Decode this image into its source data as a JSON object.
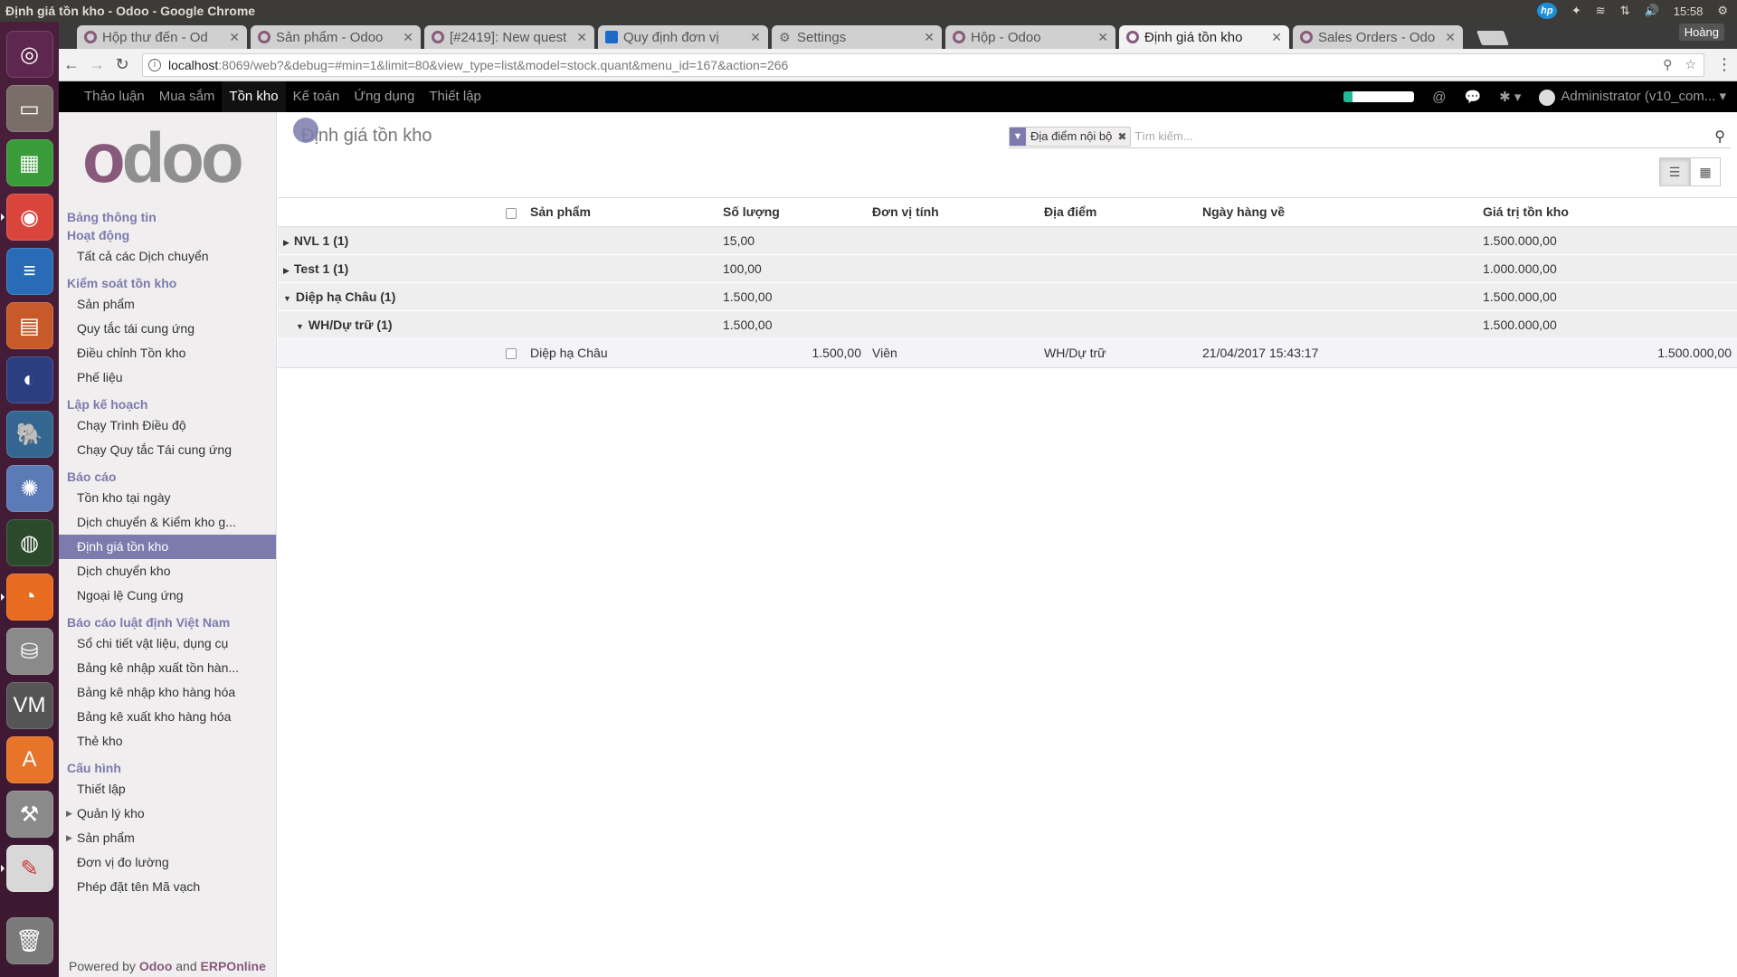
{
  "window_title": "Định giá tồn kho - Odoo - Google Chrome",
  "clock": "15:58",
  "profile_name": "Hoàng",
  "tabs": [
    {
      "label": "Hộp thư đến - Od",
      "icon": "odoo"
    },
    {
      "label": "Sản phẩm - Odoo",
      "icon": "odoo"
    },
    {
      "label": "[#2419]: New quest",
      "icon": "odoo"
    },
    {
      "label": "Quy định đơn vị",
      "icon": "blue"
    },
    {
      "label": "Settings",
      "icon": "gear"
    },
    {
      "label": "Hộp - Odoo",
      "icon": "odoo"
    },
    {
      "label": "Định giá tồn kho",
      "icon": "odoo",
      "active": true
    },
    {
      "label": "Sales Orders - Odo",
      "icon": "odoo"
    }
  ],
  "url": {
    "host": "localhost",
    "path": ":8069/web?&debug=#min=1&limit=80&view_type=list&model=stock.quant&menu_id=167&action=266"
  },
  "top_menu": [
    "Thảo luận",
    "Mua sắm",
    "Tồn kho",
    "Kế toán",
    "Ứng dụng",
    "Thiết lập"
  ],
  "top_menu_active": 2,
  "user": "Administrator (v10_com...",
  "progress": 0.12,
  "sidebar": {
    "sections": [
      {
        "head": "Bảng thông tin",
        "items": []
      },
      {
        "head": "Hoạt động",
        "items": [
          {
            "label": "Tất cả các Dịch chuyển"
          }
        ]
      },
      {
        "head": "Kiểm soát tồn kho",
        "items": [
          {
            "label": "Sản phẩm"
          },
          {
            "label": "Quy tắc tái cung ứng"
          },
          {
            "label": "Điều chỉnh Tồn kho"
          },
          {
            "label": "Phế liệu"
          }
        ]
      },
      {
        "head": "Lập kế hoạch",
        "items": [
          {
            "label": "Chạy Trình Điều độ"
          },
          {
            "label": "Chạy Quy tắc Tái cung ứng"
          }
        ]
      },
      {
        "head": "Báo cáo",
        "items": [
          {
            "label": "Tồn kho tại ngày"
          },
          {
            "label": "Dịch chuyển & Kiểm kho g..."
          },
          {
            "label": "Định giá tồn kho",
            "active": true
          },
          {
            "label": "Dịch chuyển kho"
          },
          {
            "label": "Ngoại lệ Cung ứng"
          }
        ]
      },
      {
        "head": "Báo cáo luật định Việt Nam",
        "items": [
          {
            "label": "Sổ chi tiết vật liệu, dụng cụ"
          },
          {
            "label": "Bảng kê nhập xuất tồn hàn..."
          },
          {
            "label": "Bảng kê nhập kho hàng hóa"
          },
          {
            "label": "Bảng kê xuất kho hàng hóa"
          },
          {
            "label": "Thẻ kho"
          }
        ]
      },
      {
        "head": "Cấu hình",
        "items": [
          {
            "label": "Thiết lập"
          },
          {
            "label": "Quản lý kho",
            "caret": true
          },
          {
            "label": "Sản phẩm",
            "caret": true
          },
          {
            "label": "Đơn vị đo lường"
          },
          {
            "label": "Phép đặt tên Mã vạch"
          }
        ]
      }
    ],
    "powered_prefix": "Powered by",
    "powered_odoo": "Odoo",
    "powered_and": "and",
    "powered_erp": "ERPOnline"
  },
  "main": {
    "title": "Định giá tồn kho",
    "filter_facet": "Địa điểm nội bộ",
    "search_placeholder": "Tìm kiếm...",
    "columns": [
      "Sản phẩm",
      "Số lượng",
      "Đơn vị tính",
      "Địa điểm",
      "Ngày hàng về",
      "Giá trị tồn kho"
    ],
    "groups": [
      {
        "label": "NVL 1 (1)",
        "qty": "15,00",
        "value": "1.500.000,00",
        "open": false,
        "level": 0
      },
      {
        "label": "Test 1 (1)",
        "qty": "100,00",
        "value": "1.000.000,00",
        "open": false,
        "level": 0
      },
      {
        "label": "Diệp hạ Châu (1)",
        "qty": "1.500,00",
        "value": "1.500.000,00",
        "open": true,
        "level": 0
      },
      {
        "label": "WH/Dự trữ (1)",
        "qty": "1.500,00",
        "value": "1.500.000,00",
        "open": true,
        "level": 1
      }
    ],
    "record": {
      "product": "Diệp hạ Châu",
      "qty": "1.500,00",
      "uom": "Viên",
      "location": "WH/Dự trữ",
      "date": "21/04/2017 15:43:17",
      "value": "1.500.000,00"
    }
  }
}
